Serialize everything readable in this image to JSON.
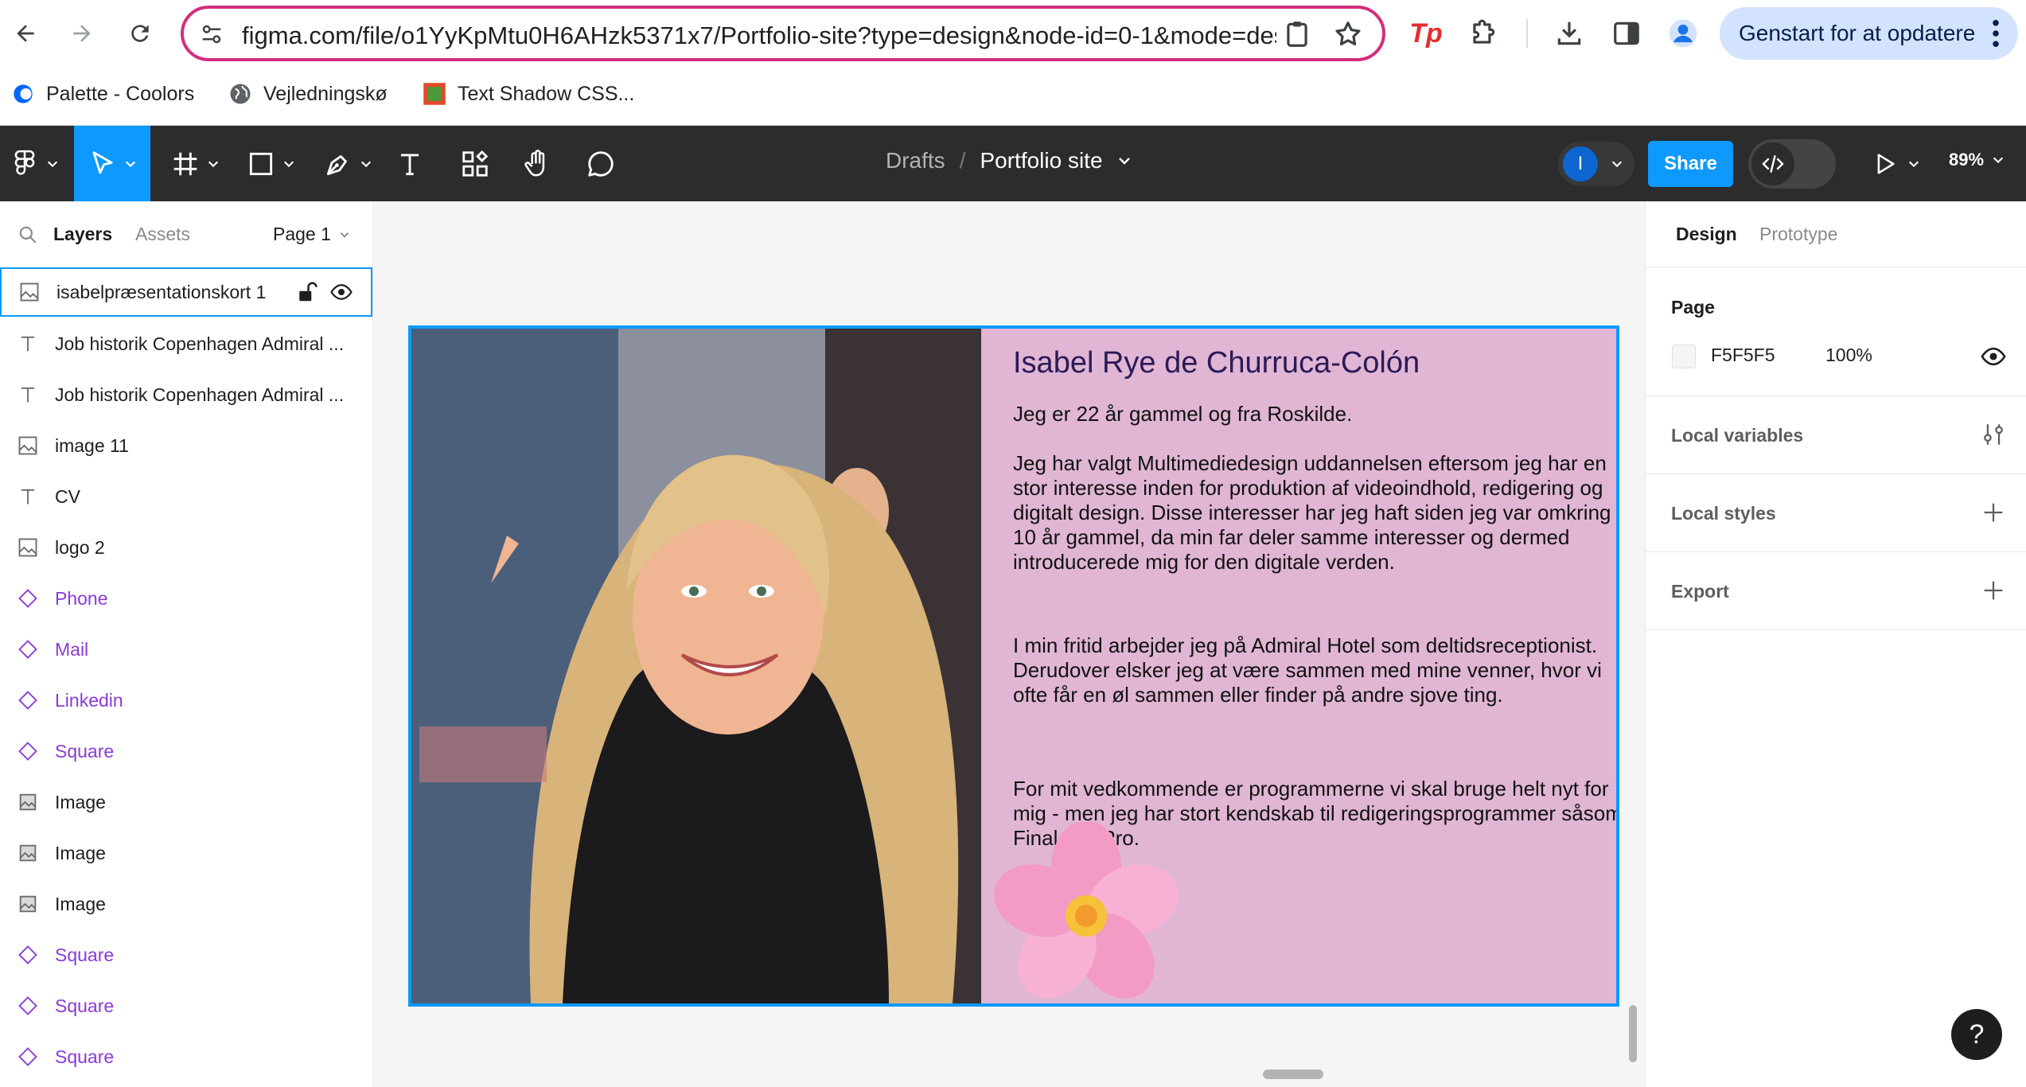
{
  "browser": {
    "url": "figma.com/file/o1YyKpMtu0H6AHzk5371x7/Portfolio-site?type=design&node-id=0-1&mode=des...",
    "update_button": "Genstart for at opdatere",
    "extension_tp": "Tp",
    "bookmarks": [
      {
        "label": "Palette - Coolors",
        "icon": "coolors-icon"
      },
      {
        "label": "Vejledningskø",
        "icon": "globe-icon"
      },
      {
        "label": "Text Shadow CSS...",
        "icon": "text-shadow-css-icon"
      }
    ]
  },
  "toolbar": {
    "breadcrumb_parent": "Drafts",
    "breadcrumb_separator": "/",
    "file_name": "Portfolio site",
    "avatar_initial": "I",
    "share_label": "Share",
    "zoom": "89%"
  },
  "left_panel": {
    "tab_layers": "Layers",
    "tab_assets": "Assets",
    "page_selector": "Page 1",
    "layers": [
      {
        "name": "isabelpræsentationskort 1",
        "type": "image",
        "selected": true
      },
      {
        "name": "Job historik Copenhagen Admiral ...",
        "type": "text"
      },
      {
        "name": "Job historik Copenhagen Admiral ...",
        "type": "text"
      },
      {
        "name": "image 11",
        "type": "image"
      },
      {
        "name": "CV",
        "type": "text"
      },
      {
        "name": "logo 2",
        "type": "image"
      },
      {
        "name": "Phone",
        "type": "component"
      },
      {
        "name": "Mail",
        "type": "component"
      },
      {
        "name": "Linkedin",
        "type": "component"
      },
      {
        "name": "Square",
        "type": "component"
      },
      {
        "name": "Image",
        "type": "image-fill"
      },
      {
        "name": "Image",
        "type": "image-fill"
      },
      {
        "name": "Image",
        "type": "image-fill"
      },
      {
        "name": "Square",
        "type": "component"
      },
      {
        "name": "Square",
        "type": "component"
      },
      {
        "name": "Square",
        "type": "component"
      }
    ]
  },
  "canvas": {
    "card": {
      "title": "Isabel Rye de Churruca-Colón",
      "paragraphs": [
        "Jeg er 22 år gammel og fra Roskilde.",
        "Jeg har valgt Multimediedesign uddannelsen eftersom jeg har en stor interesse inden for produktion af videoindhold, redigering og digitalt design. Disse interesser har jeg haft siden jeg var omkring 10 år gammel, da min far deler samme interesser og dermed introducerede mig for den digitale verden.",
        "I min fritid arbejder jeg på Admiral Hotel som deltidsreceptionist. Derudover elsker jeg at være sammen med mine venner, hvor vi ofte får en øl sammen eller finder på andre sjove ting.",
        "For mit vedkommende er programmerne vi skal bruge helt nyt for mig - men jeg har stort kendskab til redigeringsprogrammer såsom Final Cut Pro."
      ],
      "background": "#e0b6d4"
    }
  },
  "right_panel": {
    "tab_design": "Design",
    "tab_prototype": "Prototype",
    "page_heading": "Page",
    "page_color": "F5F5F5",
    "page_opacity": "100%",
    "local_variables": "Local variables",
    "local_styles": "Local styles",
    "export": "Export"
  },
  "help_label": "?",
  "colors": {
    "accent": "#0d99ff",
    "toolbar": "#2c2c2c",
    "omnibox_border": "#d12f7c",
    "component": "#8a3bd6"
  }
}
